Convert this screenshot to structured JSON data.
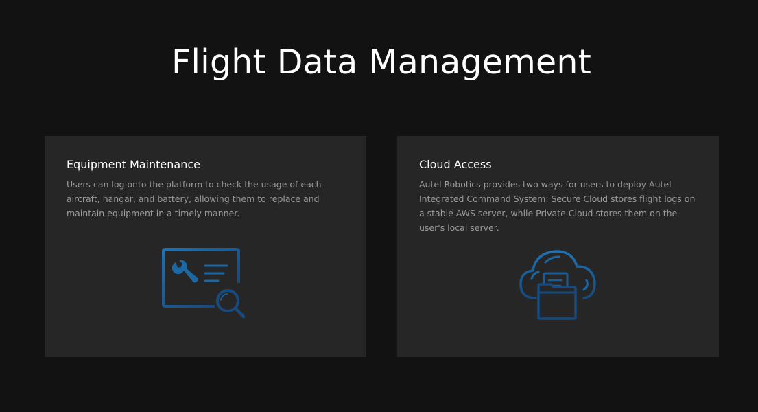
{
  "page": {
    "title": "Flight Data Management"
  },
  "cards": [
    {
      "title": "Equipment Maintenance",
      "description": "Users can log onto the platform to check the usage of each aircraft, hangar, and battery, allowing them to replace and maintain equipment in a timely manner.",
      "icon": "equipment-maintenance-icon"
    },
    {
      "title": "Cloud Access",
      "description": "Autel Robotics provides two ways for users to deploy Autel Integrated Command System: Secure Cloud stores flight logs on a stable AWS server, while Private Cloud stores them on the user's local server.",
      "icon": "cloud-folder-icon"
    }
  ],
  "colors": {
    "background": "#121212",
    "card": "#262626",
    "icon_blue": "#1e6aa8",
    "icon_blue_dark": "#174e80",
    "body_text": "#9a9a9a"
  }
}
